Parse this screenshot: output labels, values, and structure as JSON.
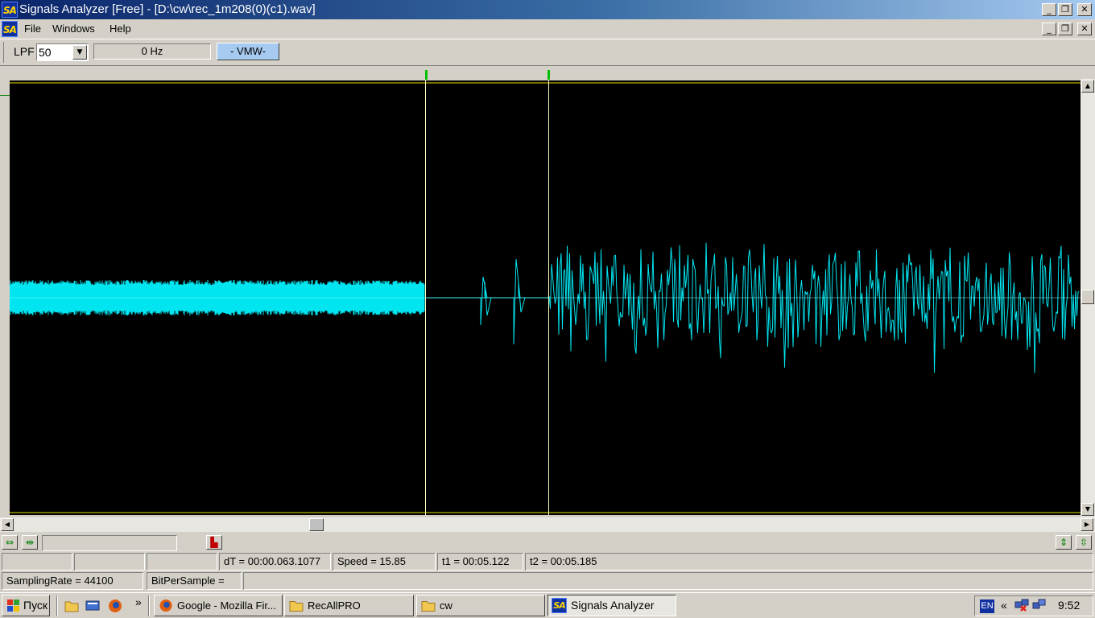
{
  "window": {
    "title": "Signals Analyzer [Free] - [D:\\cw\\rec_1m208(0)(c1).wav]",
    "logo_text": "SA",
    "minimize": "_",
    "restore": "❐",
    "close": "✕"
  },
  "menu": {
    "items": [
      "File",
      "Windows",
      "Help"
    ]
  },
  "toolbar": {
    "lpf_label": "LPF",
    "lpf_value": "50",
    "frequency": "0 Hz",
    "mode_button": "- VMW-"
  },
  "status": {
    "cell1": "",
    "cell2": "",
    "cell3": "",
    "dt": "dT = 00:00.063.1077",
    "speed": "Speed = 15.85",
    "t1": "t1 = 00:05.122",
    "t2": "t2 = 00:05.185",
    "sampling_rate": "SamplingRate = 44100",
    "bit_per_sample": "BitPerSample ="
  },
  "colors": {
    "signal": "#00e5f0",
    "cursor": "#ffffc0",
    "marker": "#00c000",
    "top_line": "#e0e000"
  },
  "taskbar": {
    "start": "Пуск",
    "quick_more": "»",
    "tasks": [
      {
        "label": "Google - Mozilla Fir...",
        "icon": "firefox-icon"
      },
      {
        "label": "RecAllPRO",
        "icon": "folder-icon"
      },
      {
        "label": "cw",
        "icon": "folder-icon"
      },
      {
        "label": "Signals Analyzer",
        "icon": "sa-icon",
        "active": true
      }
    ],
    "lang": "EN",
    "tray_expand": "«",
    "clock": "9:52"
  }
}
